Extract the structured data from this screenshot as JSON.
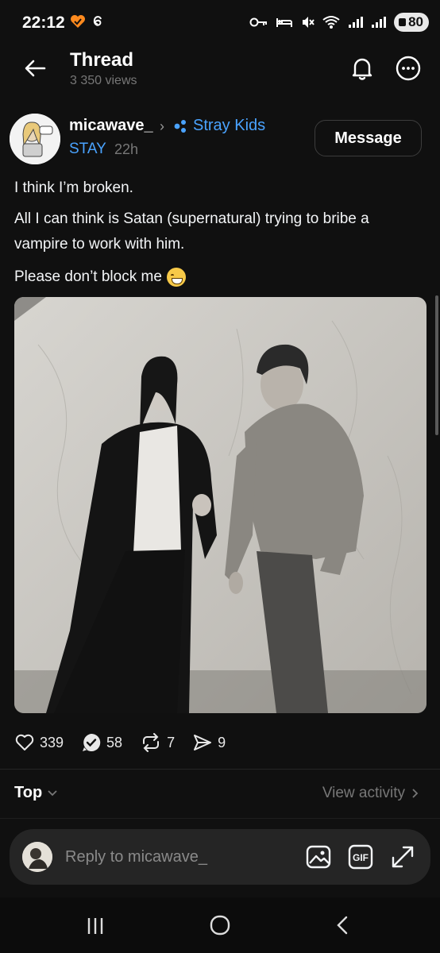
{
  "status_bar": {
    "time": "22:12",
    "battery": "80",
    "left_icons": [
      "heart-check-icon",
      "threads-icon"
    ],
    "right_icons": [
      "key-icon",
      "bed-icon",
      "mute-icon",
      "wifi-icon",
      "signal-icon",
      "signal-icon"
    ]
  },
  "header": {
    "title": "Thread",
    "views": "3 350 views"
  },
  "post": {
    "author": "micawave_",
    "community": "Stray Kids",
    "flair": "STAY",
    "time": "22h",
    "message_button": "Message",
    "paragraphs": [
      "I think I’m broken.",
      "All I can think is Satan (supernatural) trying to bribe a vampire to work with him.",
      "Please don’t block me"
    ],
    "emoji": "grinning-sweat-emoji",
    "image_alt": "Black and white photo of two men talking in front of a wooden wall",
    "likes": "339",
    "replies": "58",
    "reposts": "7",
    "shares": "9"
  },
  "comments": {
    "sort_label": "Top",
    "activity_link": "View activity"
  },
  "reply_bar": {
    "placeholder": "Reply to micawave_",
    "icons": [
      "image-icon",
      "gif-icon",
      "expand-icon"
    ]
  },
  "colors": {
    "background": "#101010",
    "accent_blue": "#4aa3ff",
    "muted": "#777777"
  }
}
